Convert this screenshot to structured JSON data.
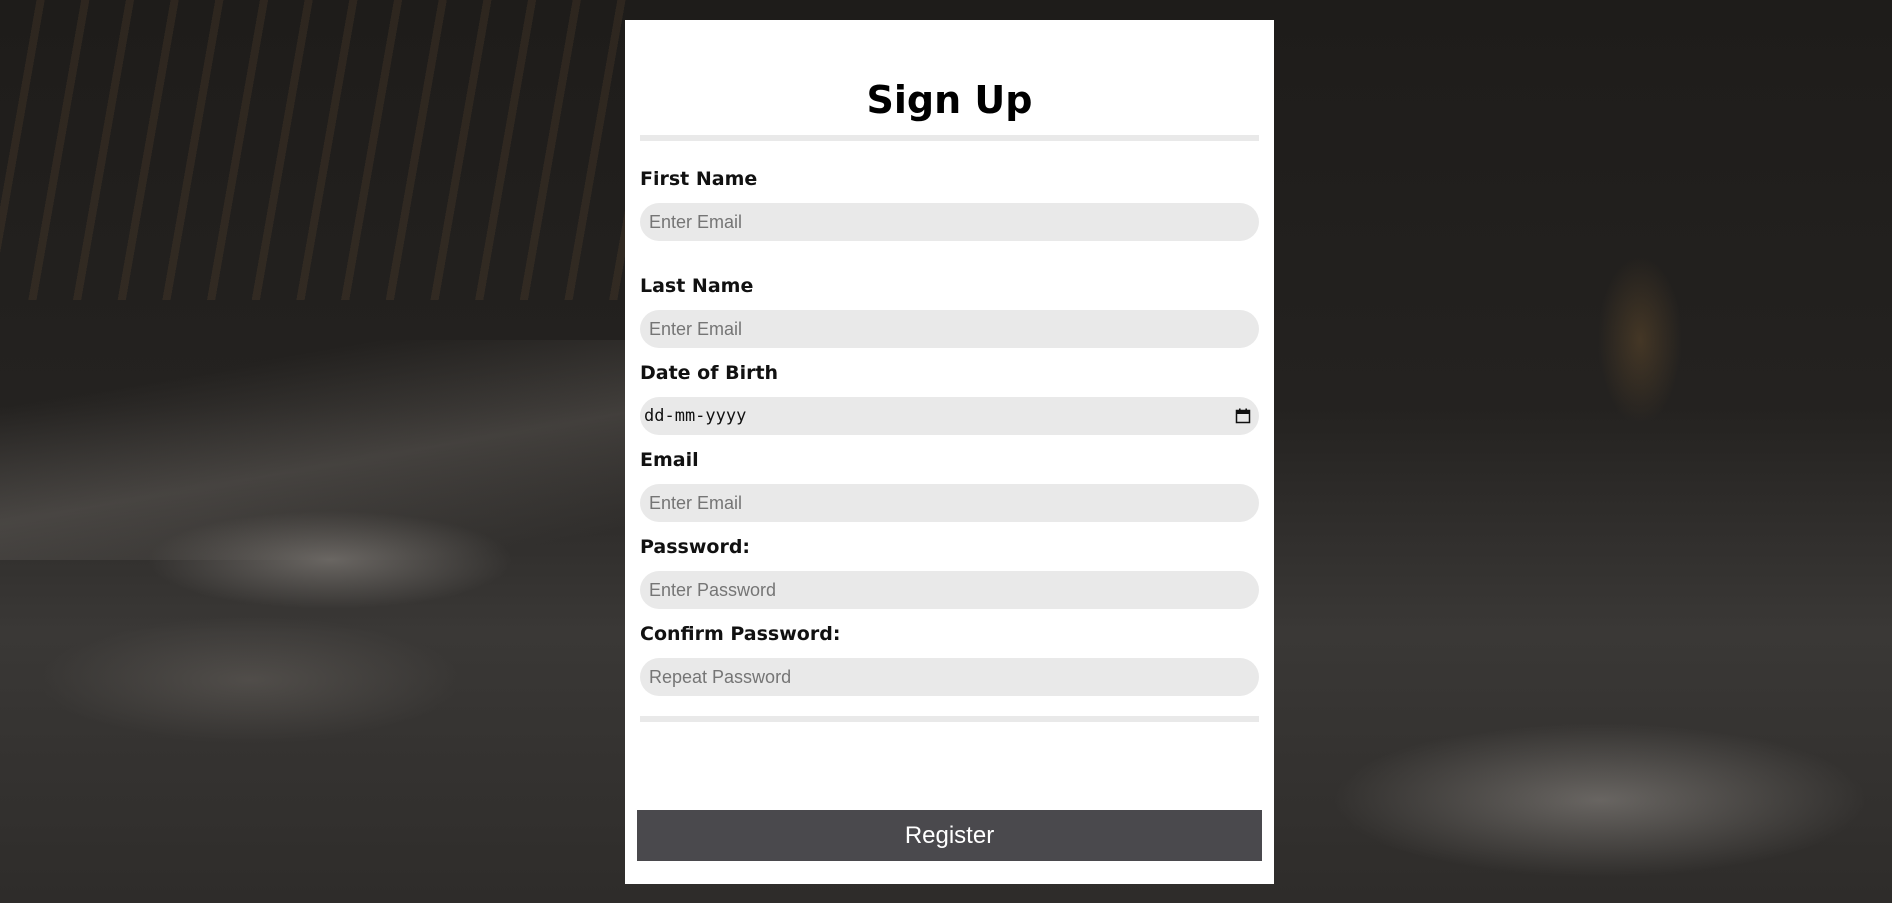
{
  "form": {
    "title": "Sign Up",
    "fields": {
      "first_name": {
        "label": "First Name",
        "placeholder": "Enter Email"
      },
      "last_name": {
        "label": "Last Name",
        "placeholder": "Enter Email"
      },
      "dob": {
        "label": "Date of Birth",
        "placeholder": "dd-mm-yyyy",
        "icon": "calendar-icon"
      },
      "email": {
        "label": "Email",
        "placeholder": "Enter Email"
      },
      "password": {
        "label": "Password:",
        "placeholder": "Enter Password"
      },
      "confirm_password": {
        "label": "Confirm Password:",
        "placeholder": "Repeat Password"
      }
    },
    "submit_label": "Register"
  },
  "colors": {
    "card_background": "#ffffff",
    "input_background": "#e9e9e9",
    "button_background": "#4a494d",
    "button_text": "#ffffff"
  }
}
